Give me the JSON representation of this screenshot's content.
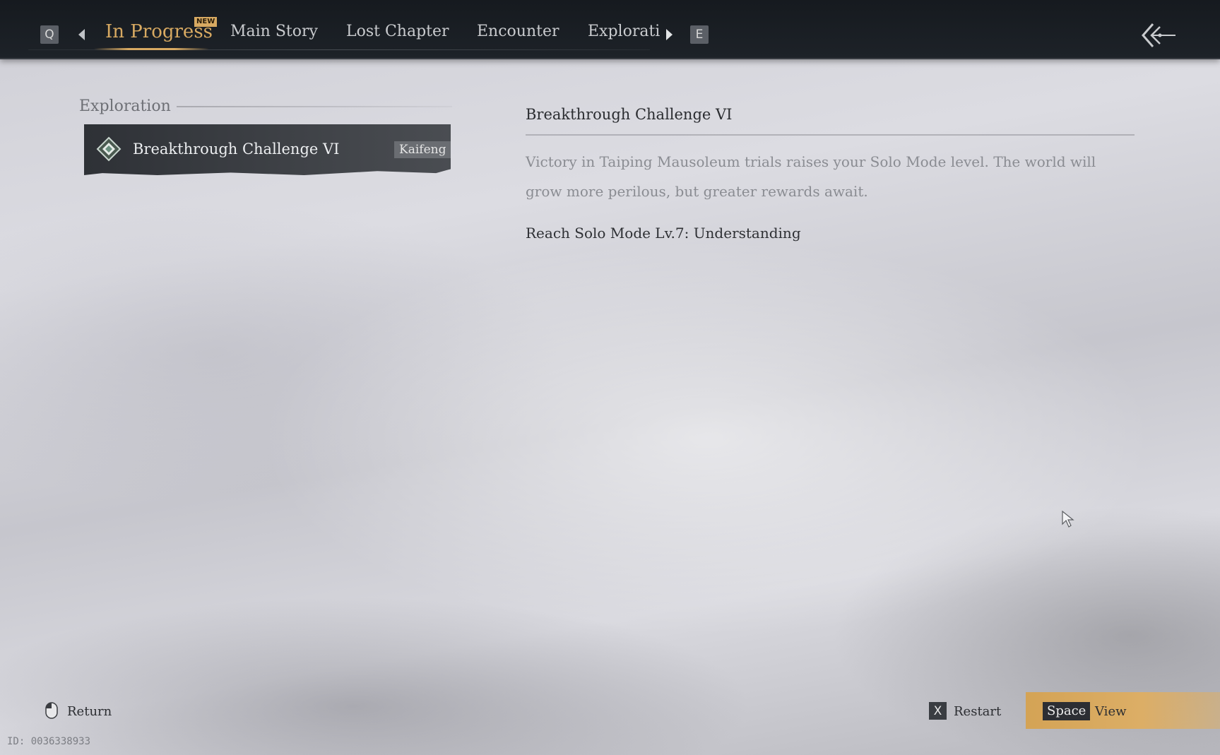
{
  "nav": {
    "prev_key": "Q",
    "next_key": "E",
    "tabs": [
      {
        "label": "In Progress",
        "active": true,
        "badge": "NEW"
      },
      {
        "label": "Main Story",
        "active": false
      },
      {
        "label": "Lost Chapter",
        "active": false
      },
      {
        "label": "Encounter",
        "active": false
      },
      {
        "label": "Explorati",
        "active": false
      }
    ]
  },
  "list": {
    "section_title": "Exploration",
    "items": [
      {
        "name": "Breakthrough Challenge VI",
        "region": "Kaifeng",
        "selected": true
      }
    ]
  },
  "detail": {
    "title": "Breakthrough Challenge VI",
    "description": "Victory in Taiping Mausoleum trials raises your Solo Mode level. The world will grow more perilous, but greater rewards await.",
    "objective": "Reach Solo Mode Lv.7: Understanding"
  },
  "actions": {
    "return_label": "Return",
    "restart_key": "X",
    "restart_label": "Restart",
    "view_key": "Space",
    "view_label": "View"
  },
  "footer": {
    "id_text": "ID: 0036338933"
  },
  "colors": {
    "accent_gold": "#d8aa62",
    "topbar": "#1a1e23"
  }
}
